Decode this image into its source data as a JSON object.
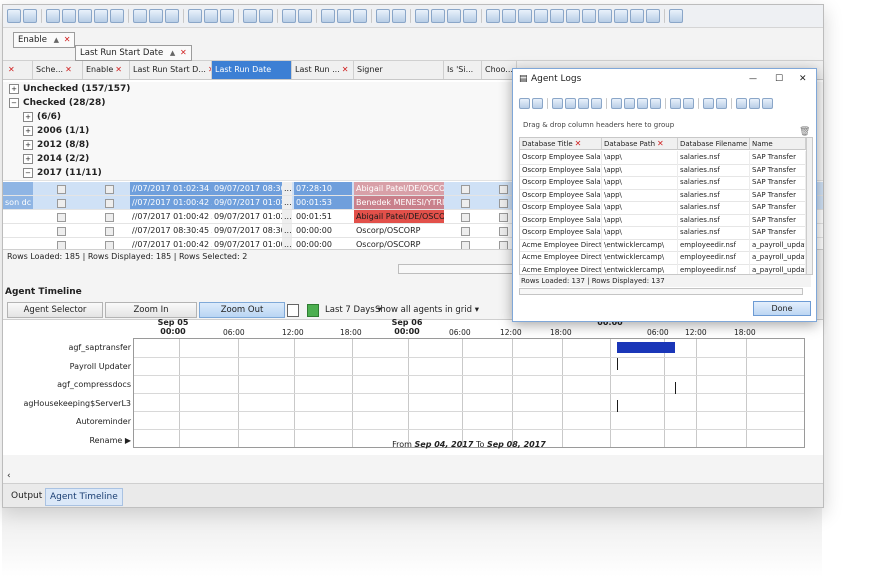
{
  "group_bar": {
    "chips": [
      {
        "label": "Enable",
        "sort": "▲",
        "filter": "✕"
      },
      {
        "label": "Last Run Start Date",
        "sort": "▲",
        "filter": "✕"
      }
    ]
  },
  "grid": {
    "columns": [
      {
        "label": "Sche..."
      },
      {
        "label": "Enable"
      },
      {
        "label": "Last Run Start D..."
      },
      {
        "label": "Last Run Date"
      },
      {
        "label": "Last Run ..."
      },
      {
        "label": "Signer"
      },
      {
        "label": "Is 'Si..."
      },
      {
        "label": "Choo..."
      }
    ],
    "groups": {
      "unchecked": "Unchecked (157/157)",
      "checked": "Checked (28/28)",
      "g_blank": "(6/6)",
      "g2006": "2006 (1/1)",
      "g2012": "2012 (8/8)",
      "g2014": "2014 (2/2)",
      "g2017": "2017 (11/11)"
    },
    "rows": [
      {
        "left": "",
        "start": "∕/07/2017 01:02:34 AM",
        "date": "09/07/2017 08:30...",
        "ellipsis": "...",
        "dur": "07:28:10",
        "signer": "Abigail Patel/DE/OSCORP",
        "style": "sel-pink"
      },
      {
        "left": "son dc",
        "start": "∕/07/2017 01:00:42 AM",
        "date": "09/07/2017 01:02...",
        "ellipsis": "...",
        "dur": "00:01:53",
        "signer": "Benedek MENESI/YTRIA",
        "style": "sel-pinkdark"
      },
      {
        "left": "",
        "start": "∕/07/2017 01:00:42 AM",
        "date": "09/07/2017 01:02...",
        "ellipsis": "...",
        "dur": "00:01:51",
        "signer": "Abigail Patel/DE/OSCORP",
        "style": "red"
      },
      {
        "left": "",
        "start": "∕/07/2017 08:30:45 AM",
        "date": "09/07/2017 08:30...",
        "ellipsis": "...",
        "dur": "00:00:00",
        "signer": "Oscorp/OSCORP",
        "style": "plain"
      },
      {
        "left": "",
        "start": "∕/07/2017 01:00:42 AM",
        "date": "09/07/2017 01:00...",
        "ellipsis": "...",
        "dur": "00:00:00",
        "signer": "Oscorp/OSCORP",
        "style": "plain"
      }
    ],
    "status": "Rows Loaded: 185  |  Rows Displayed: 185  |  Rows Selected: 2"
  },
  "timeline": {
    "title": "Agent Timeline",
    "agent_selector": "Agent Selector",
    "zoom_in": "Zoom In",
    "zoom_out": "Zoom Out",
    "range_dropdown": "Last 7 Days ▾",
    "show_dropdown": "Show all agents in grid ▾",
    "days": [
      {
        "name": "Sep 05",
        "time": "00:00"
      },
      {
        "name": "Sep 06",
        "time": "00:00"
      },
      {
        "name": "",
        "time": "00:00"
      }
    ],
    "hours": [
      "06:00",
      "12:00",
      "18:00",
      "06:00",
      "12:00",
      "18:00",
      "06:00",
      "12:00",
      "18:00"
    ],
    "agents": [
      "agf_saptransfer",
      "Payroll Updater",
      "agf_compressdocs",
      "agHousekeeping$ServerL3",
      "Autoreminder",
      "Rename ▶"
    ],
    "range_text": {
      "prefix": "From ",
      "from": "Sep 04, 2017",
      "mid": " To ",
      "to": "Sep 08, 2017"
    }
  },
  "bottom_tabs": {
    "output": "Output",
    "agent_timeline": "Agent Timeline"
  },
  "dialog": {
    "title": "Agent Logs",
    "minimize": "—",
    "maximize": "☐",
    "close": "✕",
    "drag_hint": "Drag & drop column headers here to group",
    "columns": [
      "Database Title",
      "Database Path",
      "Database Filename",
      "Name"
    ],
    "rows": [
      [
        "Oscorp Employee Salaries",
        "\\app\\",
        "salaries.nsf",
        "SAP Transfer"
      ],
      [
        "Oscorp Employee Salaries",
        "\\app\\",
        "salaries.nsf",
        "SAP Transfer"
      ],
      [
        "Oscorp Employee Salaries",
        "\\app\\",
        "salaries.nsf",
        "SAP Transfer"
      ],
      [
        "Oscorp Employee Salaries",
        "\\app\\",
        "salaries.nsf",
        "SAP Transfer"
      ],
      [
        "Oscorp Employee Salaries",
        "\\app\\",
        "salaries.nsf",
        "SAP Transfer"
      ],
      [
        "Oscorp Employee Salaries",
        "\\app\\",
        "salaries.nsf",
        "SAP Transfer"
      ],
      [
        "Oscorp Employee Salaries",
        "\\app\\",
        "salaries.nsf",
        "SAP Transfer"
      ],
      [
        "Acme Employee Directory",
        "\\entwicklercamp\\",
        "employeedir.nsf",
        "a_payroll_updater"
      ],
      [
        "Acme Employee Directory",
        "\\entwicklercamp\\",
        "employeedir.nsf",
        "a_payroll_updater"
      ],
      [
        "Acme Employee Directory",
        "\\entwicklercamp\\",
        "employeedir.nsf",
        "a_payroll_updater"
      ],
      [
        "Acme Employee Directory",
        "\\entwicklercamp\\",
        "employeedir.nsf",
        "a_payroll_updater"
      ]
    ],
    "status": "Rows Loaded: 137  |  Rows Displayed: 137",
    "done": "Done"
  },
  "colors": {
    "selected_header": "#3c7fd4",
    "selected_row": "#cfe1f6",
    "pink": "#d8a0a8",
    "pink_dark": "#c9808b",
    "red": "#e2504a",
    "timeline_bar": "#1a36b8"
  }
}
